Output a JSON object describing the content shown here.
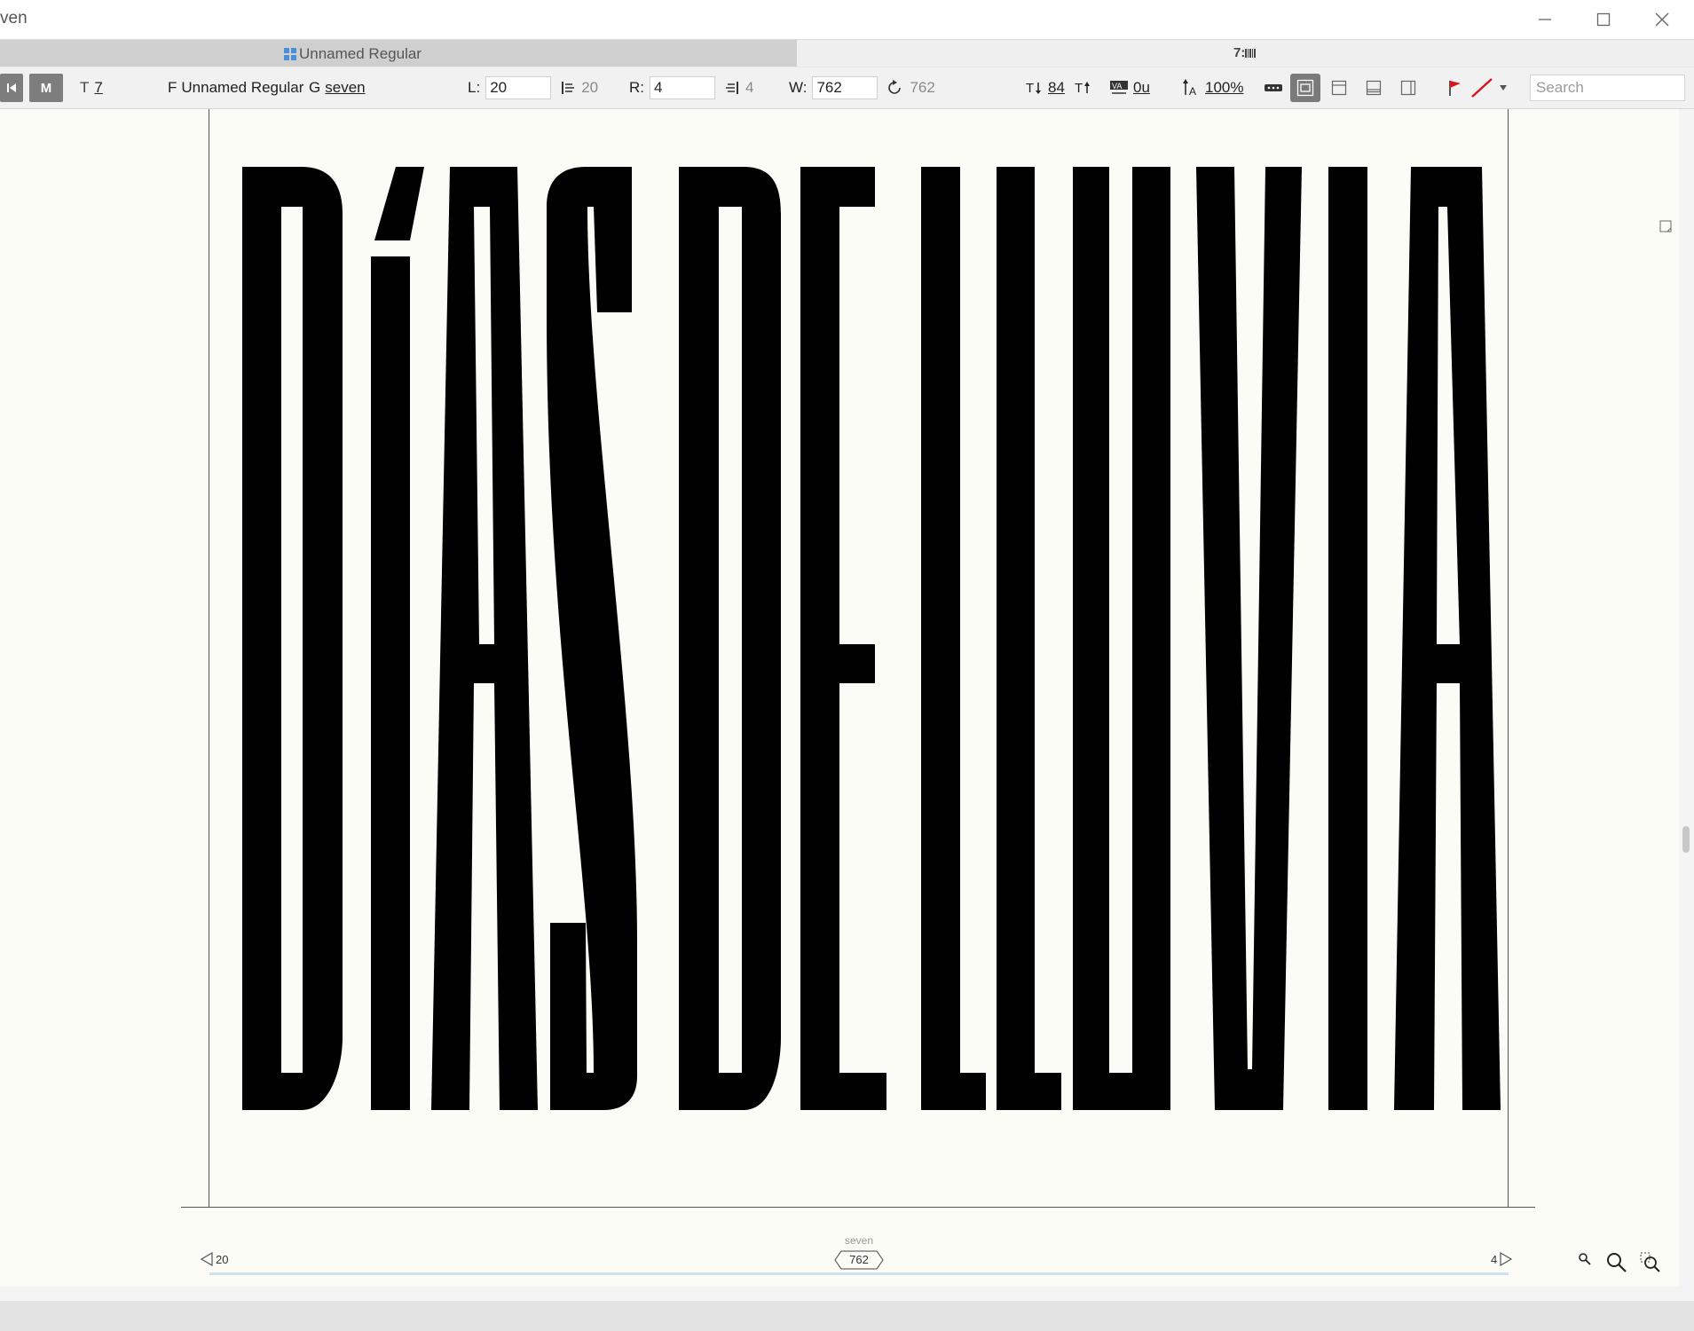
{
  "window": {
    "title": "ven",
    "controls": [
      "minimize-icon",
      "maximize-icon",
      "close-icon"
    ]
  },
  "tabs": {
    "active_label": "Unnamed Regular",
    "right_label": "7:"
  },
  "toolbar": {
    "mode_buttons": [
      "",
      "M"
    ],
    "text_tool_label": "T",
    "text_tool_value": "7",
    "font_prefix": "F",
    "font_name": "Unnamed Regular",
    "glyph_prefix": "G",
    "glyph_name": "seven",
    "left_label": "L:",
    "left_value": "20",
    "left_computed": "20",
    "right_label": "R:",
    "right_value": "4",
    "right_computed": "4",
    "width_label": "W:",
    "width_value": "762",
    "width_computed": "762",
    "ascender_value": "84",
    "kerning_value": "0u",
    "zoom_value": "100%",
    "search_placeholder": "Search"
  },
  "canvas": {
    "preview_text": "DÍAS DE LLUVIA",
    "glyph_label": "seven",
    "width_badge": "762",
    "left_sidebearing": "20",
    "right_sidebearing": "4"
  },
  "colors": {
    "accent_red": "#d9141b",
    "toolbar_bg": "#f1f1f1",
    "canvas_bg": "#fcfcf7",
    "tab_active_bg": "#cfcfcf"
  }
}
